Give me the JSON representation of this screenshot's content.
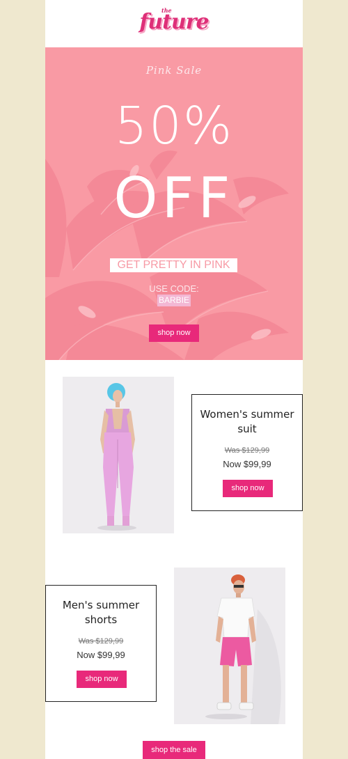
{
  "header": {
    "logo_small": "the",
    "logo_main": "future"
  },
  "hero": {
    "eyebrow": "Pink Sale",
    "headline_line1": "50%",
    "headline_line2": "OFF",
    "tagline": "GET PRETTY IN PINK",
    "code_label": "USE CODE:",
    "code": "BARBIE",
    "cta": "shop now",
    "background_color": "#f99aa4"
  },
  "products": [
    {
      "title_line1": "Women's summer",
      "title_line2": "suit",
      "was_price": "Was $129,99",
      "now_price": "Now $99,99",
      "cta": "shop now",
      "image_icon": "woman-pink-suit-photo"
    },
    {
      "title_line1": "Men's summer",
      "title_line2": "shorts",
      "was_price": "Was $129,99",
      "now_price": "Now $99,99",
      "cta": "shop now",
      "image_icon": "man-pink-shorts-photo"
    }
  ],
  "footer": {
    "cta": "shop the sale"
  },
  "colors": {
    "accent": "#e8297a",
    "page_background": "#efe8cf",
    "hero_pink": "#f99aa4"
  }
}
